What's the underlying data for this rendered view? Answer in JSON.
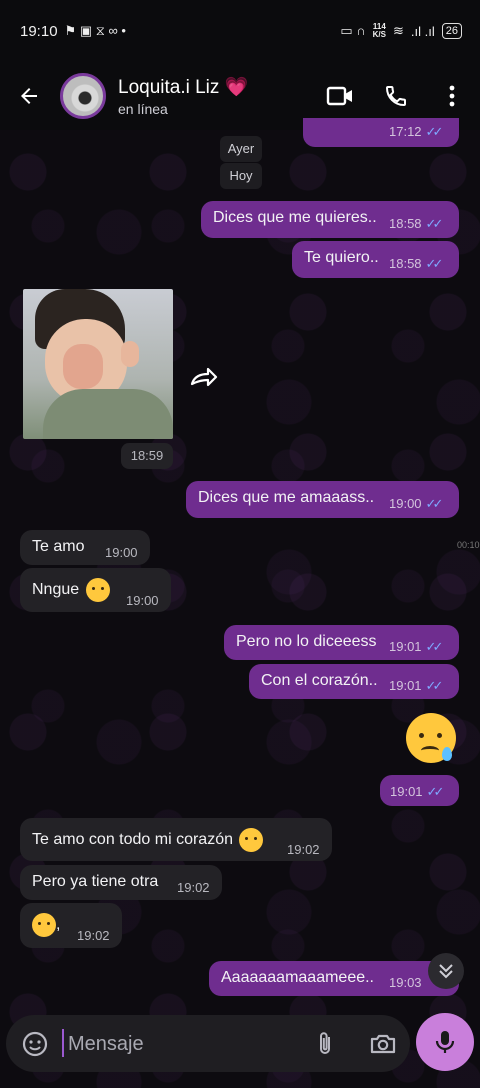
{
  "status_bar": {
    "time": "19:10",
    "speed_top": "114",
    "speed_bottom": "K/S",
    "battery": "26"
  },
  "header": {
    "contact_name": "Loquita.i Liz",
    "heart": "💗",
    "contact_status": "en línea"
  },
  "chat": {
    "partial_top_time": "17:12",
    "date_yesterday": "Ayer",
    "date_today": "Hoy",
    "messages": [
      {
        "text": "Dices que me quieres..",
        "time": "18:58"
      },
      {
        "text": "Te quiero..",
        "time": "18:58"
      },
      {
        "text": "",
        "time": "18:59"
      },
      {
        "text": "Dices que me amaaass..",
        "time": "19:00"
      },
      {
        "text": "Te amo",
        "time": "19:00"
      },
      {
        "text": "Nngue",
        "time": "19:00"
      },
      {
        "text": "Pero no lo diceeess",
        "time": "19:01"
      },
      {
        "text": "Con el corazón..",
        "time": "19:01"
      },
      {
        "text": "",
        "time": "19:01"
      },
      {
        "text": "Te amo con todo mi corazón",
        "time": "19:02"
      },
      {
        "text": "Pero ya tiene otra",
        "time": "19:02"
      },
      {
        "text": ",",
        "time": "19:02"
      },
      {
        "text": "Aaaaaaamaaameee..",
        "time": "19:03"
      }
    ],
    "side_time": "00:10"
  },
  "input": {
    "placeholder": "Mensaje"
  },
  "colors": {
    "outgoing": "#6f2d8f",
    "incoming": "#232226",
    "mic": "#c97fdb",
    "ticks": "#7fa9ff"
  },
  "icons": [
    "back-arrow-icon",
    "video-call-icon",
    "phone-icon",
    "more-vert-icon",
    "forward-icon",
    "emoji-icon",
    "attach-icon",
    "camera-icon",
    "mic-icon",
    "double-chevron-down-icon"
  ]
}
